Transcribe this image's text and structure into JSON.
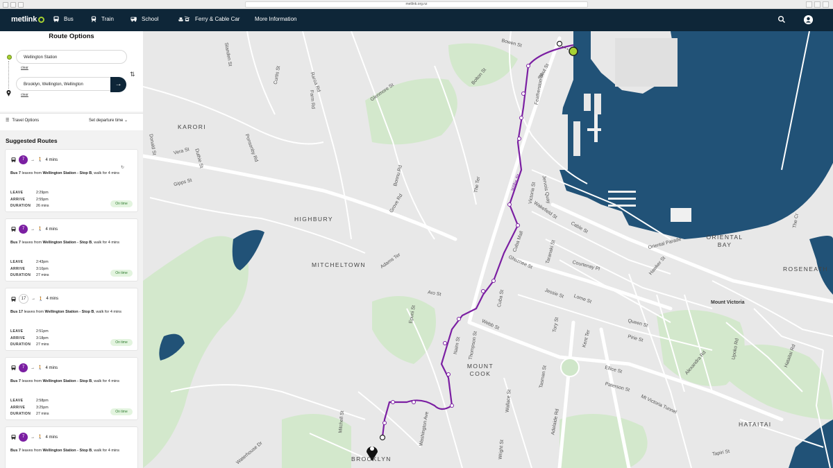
{
  "browser": {
    "url": "metlink.org.nz"
  },
  "nav": {
    "logo": "metlink",
    "items": [
      {
        "label": "Bus",
        "icon": "bus-icon"
      },
      {
        "label": "Train",
        "icon": "train-icon"
      },
      {
        "label": "School",
        "icon": "school-bus-icon"
      },
      {
        "label": "Ferry & Cable Car",
        "icon": "ferry-cablecar-icon"
      },
      {
        "label": "More Information",
        "icon": ""
      }
    ]
  },
  "route_options": {
    "title": "Route Options",
    "from": "Wellington Station",
    "to": "Brooklyn, Wellington, Wellington",
    "clear": "clear",
    "travel_options": "Travel Options",
    "departure": "Set departure time"
  },
  "suggested": {
    "title": "Suggested Routes",
    "cards": [
      {
        "route": "7",
        "walk": "4 mins",
        "desc_pre": "Bus 7",
        "desc_mid": " leaves from ",
        "stop": "Wellington Station - Stop B",
        "desc_post": ", walk for 4 mins",
        "leave": "2:29pm",
        "arrive": "2:55pm",
        "duration": "26 mins",
        "status": "On time"
      },
      {
        "route": "7",
        "walk": "4 mins",
        "desc_pre": "Bus 7",
        "desc_mid": " leaves from ",
        "stop": "Wellington Station - Stop B",
        "desc_post": ", walk for 4 mins",
        "leave": "2:43pm",
        "arrive": "3:10pm",
        "duration": "27 mins",
        "status": "On time"
      },
      {
        "route": "17",
        "walk": "4 mins",
        "desc_pre": "Bus 17",
        "desc_mid": " leaves from ",
        "stop": "Wellington Station - Stop B",
        "desc_post": ", walk for 4 mins",
        "leave": "2:51pm",
        "arrive": "3:18pm",
        "duration": "27 mins",
        "status": "On time"
      },
      {
        "route": "7",
        "walk": "4 mins",
        "desc_pre": "Bus 7",
        "desc_mid": " leaves from ",
        "stop": "Wellington Station - Stop B",
        "desc_post": ", walk for 4 mins",
        "leave": "2:58pm",
        "arrive": "3:25pm",
        "duration": "27 mins",
        "status": "On time"
      },
      {
        "route": "7",
        "walk": "4 mins",
        "desc_pre": "Bus 7",
        "desc_mid": " leaves from ",
        "stop": "Wellington Station - Stop B",
        "desc_post": ", walk for 4 mins"
      }
    ],
    "labels": {
      "leave": "LEAVE",
      "arrive": "ARRIVE",
      "duration": "DURATION"
    }
  },
  "map": {
    "suburbs": [
      "KARORI",
      "HIGHBURY",
      "MITCHELTOWN",
      "MOUNT COOK",
      "BROOKLYN",
      "ORIENTAL BAY",
      "ROSENEATH",
      "HATAITAI"
    ],
    "places": [
      "Mount Victoria"
    ],
    "streets": [
      "Bowen St",
      "Bolton St",
      "Glenmore St",
      "Curtis St",
      "Standen St",
      "Raroa Rd",
      "Farm Rd",
      "Donald St",
      "Vera St",
      "Duthie St",
      "Gipps St",
      "Ponsonby Rd",
      "Aro St",
      "Adams Ter",
      "Grove Rd",
      "Bonnu Rd",
      "The Ter",
      "Victoria St",
      "Willis St",
      "Cuba St",
      "Cuba Mall",
      "Ghuznee St",
      "Taranaki St",
      "Wakefield St",
      "Jervois Quay",
      "Cable St",
      "Oriental Parade",
      "Courtenay Pl",
      "Jessie St",
      "Lorne St",
      "Tory St",
      "Kent Ter",
      "Webb St",
      "Thompson St",
      "Nairn St",
      "Tasman St",
      "Wallace St",
      "Wright St",
      "Adelaide Rd",
      "Washington Ave",
      "Mitchell St",
      "Waterhouse Dr",
      "Epuni St",
      "Hawker St",
      "Queen St",
      "Pirie St",
      "Ellice St",
      "Paterson St",
      "Mt Victoria Tunnel",
      "Alexandra Rd",
      "Hataitai Rd",
      "Tapiri St",
      "Featherston St",
      "Stout St",
      "The Cr",
      "Upoko Rd"
    ]
  },
  "colors": {
    "nav": "#0e2638",
    "route": "#7b1fa2",
    "water": "#215277",
    "park": "#cfe6c9",
    "accent": "#a6d233"
  }
}
